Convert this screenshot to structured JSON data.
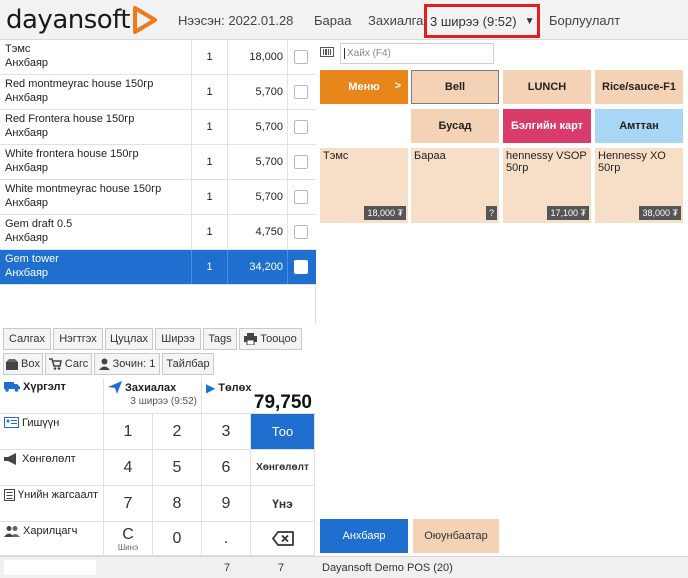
{
  "header": {
    "logo_text": "dayansoft",
    "opened_label": "Нээсэн: 2022.01.28",
    "goods_label": "Бараа",
    "order_label": "Захиалга",
    "table_select_value": "3 ширээ (9:52)",
    "sales_label": "Борлуулалт"
  },
  "order_items": [
    {
      "name": "Тэмс",
      "waiter": "Анхбаяр",
      "qty": "1",
      "price": "18,000"
    },
    {
      "name": "Red montmeyrac house 150гр",
      "waiter": "Анхбаяр",
      "qty": "1",
      "price": "5,700"
    },
    {
      "name": "Red Frontera house 150гр",
      "waiter": "Анхбаяр",
      "qty": "1",
      "price": "5,700"
    },
    {
      "name": "White frontera house 150гр",
      "waiter": "Анхбаяр",
      "qty": "1",
      "price": "5,700"
    },
    {
      "name": "White montmeyrac house 150гр",
      "waiter": "Анхбаяр",
      "qty": "1",
      "price": "5,700"
    },
    {
      "name": "Gem draft 0.5",
      "waiter": "Анхбаяр",
      "qty": "1",
      "price": "4,750"
    },
    {
      "name": "Gem tower",
      "waiter": "Анхбаяр",
      "qty": "1",
      "price": "34,200"
    }
  ],
  "actions": {
    "move": "Салгах",
    "merge": "Нэгтгэх",
    "cancel": "Цуцлах",
    "table": "Ширээ",
    "tags": "Tags",
    "print": "Тооцоо",
    "box": "Box",
    "cart": "Сагс",
    "guests": "Зочин: 1",
    "note": "Тайлбар"
  },
  "order_info": {
    "delivery_label": "Хүргэлт",
    "order_label": "Захиалах",
    "order_table": "3 ширээ (9:52)",
    "pay_label": "Төлөх",
    "total": "79,750"
  },
  "side_menu": {
    "discount": "Гишүүн",
    "promo": "Хөнгөлөлт",
    "vat": "Үнийн жагсаалт",
    "customer": "Харилцагч"
  },
  "keypad": {
    "k1": "1",
    "k2": "2",
    "k3": "3",
    "k4": "4",
    "k5": "5",
    "k6": "6",
    "k7": "7",
    "k8": "8",
    "k9": "9",
    "clear": "C",
    "clear_sub": "Шинэ",
    "k0": "0",
    "dot": ".",
    "qty_btn": "Тоо",
    "discount_btn": "Хөнгөлөлт",
    "price_btn": "Үнэ"
  },
  "search": {
    "placeholder": "Хайх (F4)"
  },
  "categories": {
    "menu": "Меню",
    "menu_arrow": ">",
    "bell": "Bell",
    "lunch": "LUNCH",
    "rice": "Rice/sauce-F1",
    "other": "Бусад",
    "customer_card": "Бэлгийн карт",
    "amttan": "Амттан"
  },
  "products": [
    {
      "name": "Тэмс",
      "price": "18,000 ₮"
    },
    {
      "name": "Бараа",
      "price": "?"
    },
    {
      "name": "hennessy VSOP 50гр",
      "price": "17,100 ₮"
    },
    {
      "name": "Hennessy XO 50гр",
      "price": "38,000 ₮"
    }
  ],
  "waiters": {
    "w1": "Анхбаяр",
    "w2": "Оюунбаатар"
  },
  "status": {
    "count1": "7",
    "count2": "7",
    "app_name": "Dayansoft Demo POS (20)"
  },
  "colors": {
    "accent": "#1e6fd0",
    "menu": "#e8861a",
    "tile": "#f4d2b5",
    "card": "#d93b6b",
    "dessert": "#a9d6f5",
    "highlight": "#e02020"
  }
}
